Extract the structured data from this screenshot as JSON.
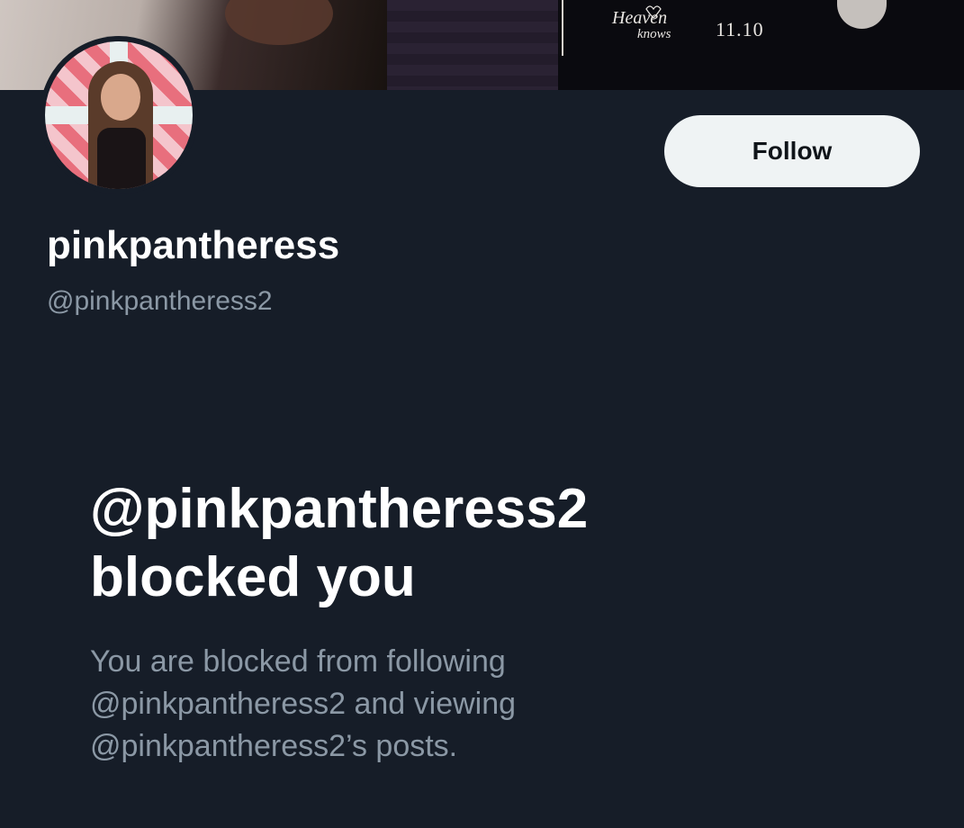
{
  "banner": {
    "logo_text_line1": "Heaven",
    "logo_text_line2": "knows",
    "date": "11.10"
  },
  "profile": {
    "display_name": "pinkpantheress",
    "handle": "@pinkpantheress2",
    "follow_label": "Follow"
  },
  "blocked": {
    "title_line1": "@pinkpantheress2",
    "title_line2": "blocked you",
    "body_line1": "You are blocked from following",
    "body_line2": "@pinkpantheress2 and viewing",
    "body_line3": "@pinkpantheress2’s posts."
  },
  "colors": {
    "background": "#161d28",
    "secondary_text": "#8b98a5",
    "button_bg": "#eff3f4"
  }
}
